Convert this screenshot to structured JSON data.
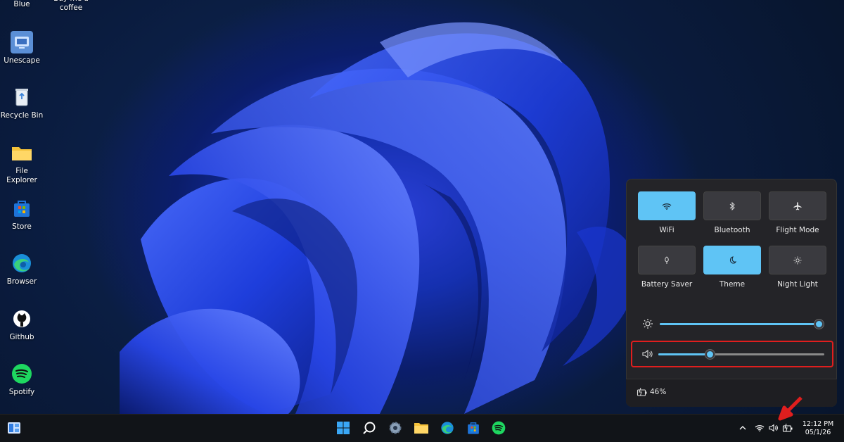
{
  "desktop": {
    "icons": [
      {
        "label": "Blue",
        "icon": "blue-app-icon"
      },
      {
        "label": "Buy me a coffee",
        "icon": "coffee-icon"
      },
      {
        "label": "Unescape",
        "icon": "unescape-icon"
      },
      {
        "label": "Recycle Bin",
        "icon": "recycle-bin-icon"
      },
      {
        "label": "File Explorer",
        "icon": "folder-icon"
      },
      {
        "label": "Store",
        "icon": "store-icon"
      },
      {
        "label": "Browser",
        "icon": "edge-icon"
      },
      {
        "label": "Github",
        "icon": "github-icon"
      },
      {
        "label": "Spotify",
        "icon": "spotify-icon"
      }
    ]
  },
  "quick_settings": {
    "tiles": [
      {
        "label": "WiFi",
        "icon": "wifi-icon",
        "active": true
      },
      {
        "label": "Bluetooth",
        "icon": "bluetooth-icon",
        "active": false
      },
      {
        "label": "Flight Mode",
        "icon": "airplane-icon",
        "active": false
      },
      {
        "label": "Battery Saver",
        "icon": "battery-saver-icon",
        "active": false
      },
      {
        "label": "Theme",
        "icon": "moon-icon",
        "active": true
      },
      {
        "label": "Night Light",
        "icon": "sun-icon",
        "active": false
      }
    ],
    "brightness": {
      "icon": "brightness-icon",
      "value_fraction": 1.0
    },
    "volume": {
      "icon": "speaker-icon",
      "value_fraction": 0.3,
      "highlighted": true
    },
    "battery": {
      "icon": "battery-charging-icon",
      "text": "46%"
    }
  },
  "taskbar": {
    "left": [
      {
        "icon": "widgets-icon"
      }
    ],
    "center": [
      {
        "icon": "windows-start-icon"
      },
      {
        "icon": "search-icon"
      },
      {
        "icon": "settings-icon"
      },
      {
        "icon": "file-explorer-icon"
      },
      {
        "icon": "edge-icon"
      },
      {
        "icon": "store-icon"
      },
      {
        "icon": "spotify-icon"
      }
    ],
    "tray": [
      {
        "icon": "chevron-up-icon"
      },
      {
        "icon": "wifi-icon"
      },
      {
        "icon": "speaker-icon"
      },
      {
        "icon": "battery-icon"
      }
    ],
    "clock": {
      "time": "12:12 PM",
      "date": "05/1/26"
    }
  },
  "colors": {
    "accent": "#5fc4f5",
    "highlight": "#e01e1e",
    "panel": "#242428"
  }
}
